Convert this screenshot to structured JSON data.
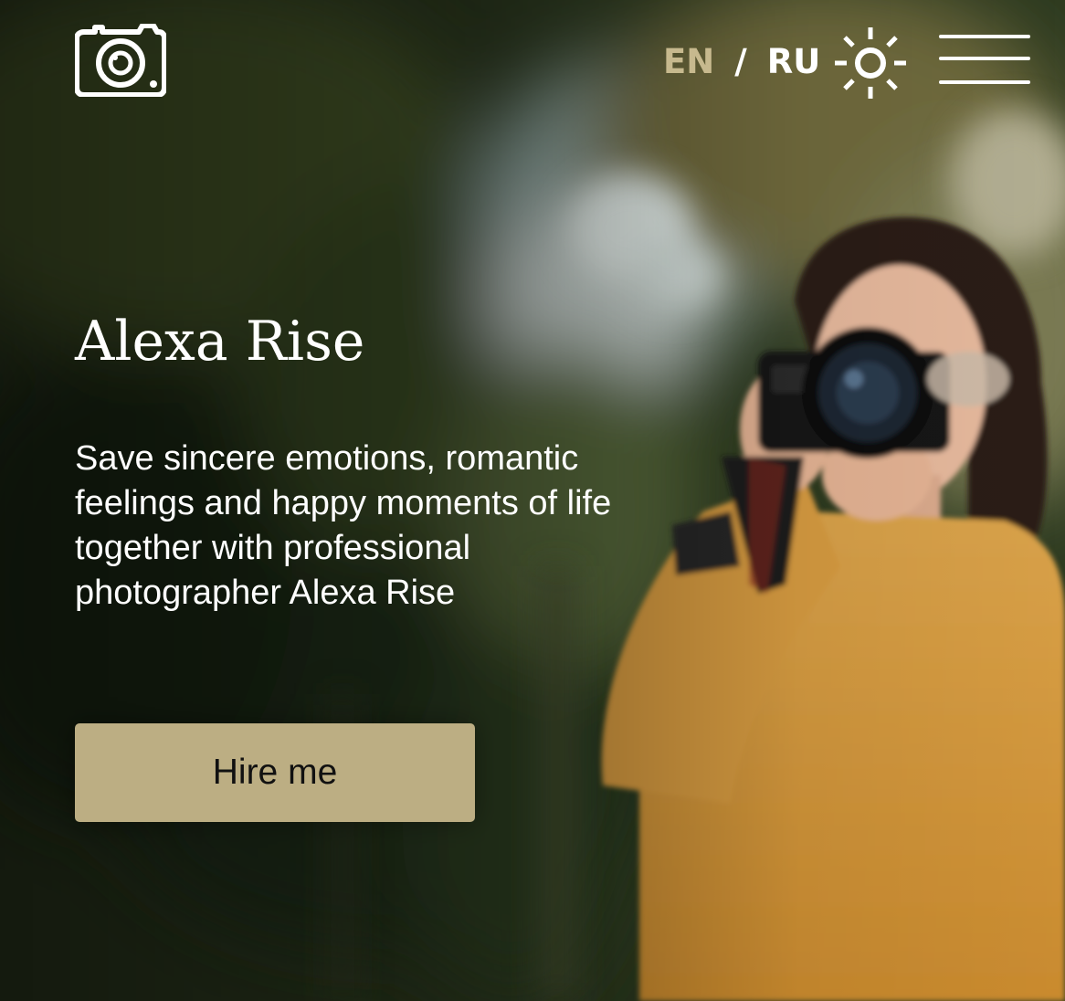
{
  "header": {
    "logo_icon": "camera-icon",
    "lang_active": "EN",
    "lang_separator": "/",
    "lang_other": "RU",
    "theme_icon": "sun-icon",
    "menu_icon": "hamburger-menu-icon"
  },
  "hero": {
    "title": "Alexa Rise",
    "subtitle": "Save sincere emotions, romantic feelings and happy moments of life together with professional photographer Alexa Rise",
    "cta_label": "Hire me",
    "background": "photographer-with-camera-photo"
  },
  "colors": {
    "accent": "#bcae83",
    "lang_active": "#c7b98e",
    "text": "#ffffff"
  }
}
